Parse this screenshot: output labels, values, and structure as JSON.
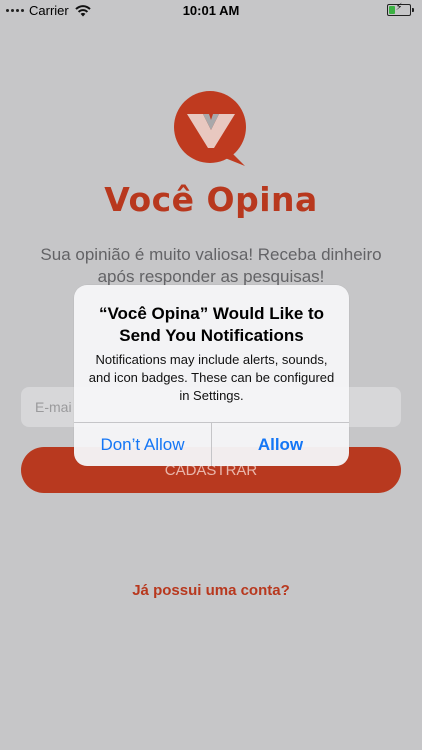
{
  "status_bar": {
    "carrier": "Carrier",
    "time": "10:01 AM",
    "battery_level": 0.35,
    "wifi_icon": "wifi-icon",
    "battery_icon": "battery-charging-icon"
  },
  "app": {
    "logo_icon": "checkmark-speech-bubble-logo",
    "brand_name": "Você Opina",
    "tagline": "Sua opinião é muito valiosa! Receba dinheiro após responder as pesquisas!",
    "email_placeholder": "E-mail",
    "email_placeholder_visible": "E-mai",
    "signup_label": "CADASTRAR",
    "login_link": "Já possui uma conta?",
    "brand_color": "#b8381e"
  },
  "alert": {
    "title": "“Você Opina” Would Like to Send You Notifications",
    "message": "Notifications may include alerts, sounds, and icon badges. These can be configured in Settings.",
    "deny_label": "Don’t Allow",
    "allow_label": "Allow",
    "button_color": "#1476f5"
  }
}
